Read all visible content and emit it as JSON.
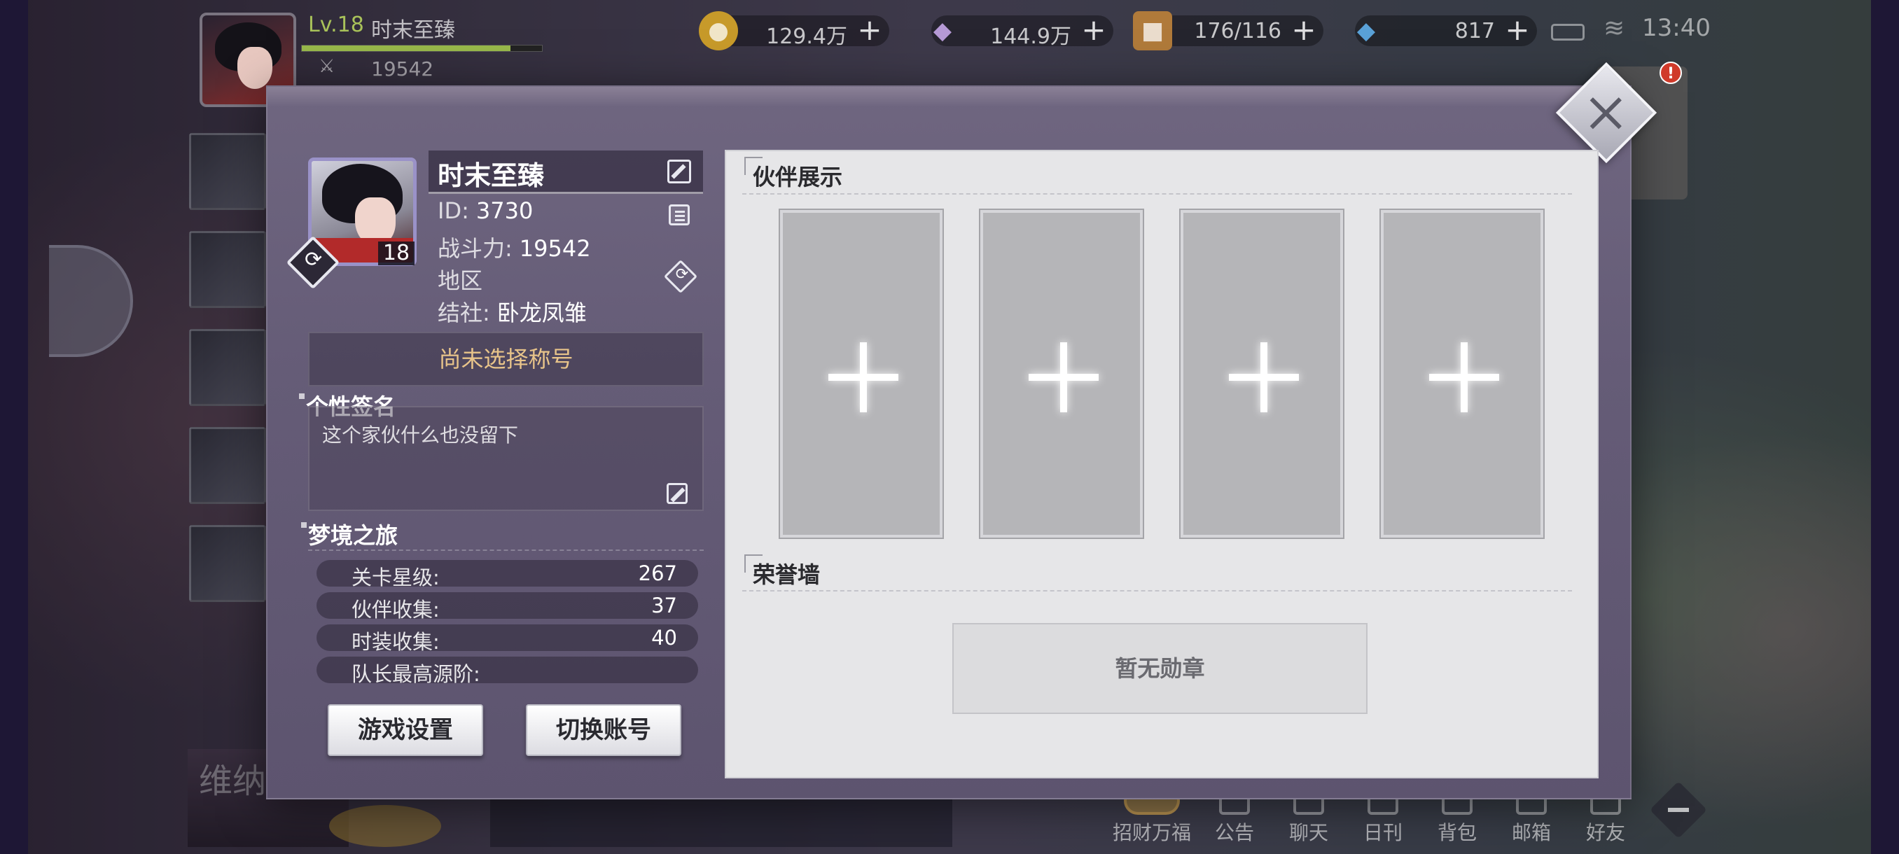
{
  "hud": {
    "level": "Lv.18",
    "player_name": "时末至臻",
    "power": "19542",
    "xp_fraction": 0.87,
    "resources": [
      {
        "icon": "gold-coin-icon",
        "value": "129.4万"
      },
      {
        "icon": "crystal-icon",
        "value": "144.9万"
      },
      {
        "icon": "stamina-chest-icon",
        "value": "176/116"
      },
      {
        "icon": "diamond-icon",
        "value": "817"
      }
    ],
    "time": "13:40"
  },
  "bottom_nav": [
    "招财万福",
    "公告",
    "聊天",
    "日刊",
    "背包",
    "邮箱",
    "好友"
  ],
  "profile": {
    "name": "时末至臻",
    "avatar_level": "18",
    "id_label": "ID:",
    "id_value": "3730",
    "power_label": "战斗力:",
    "power_value": "19542",
    "region_label": "地区",
    "guild_label": "结社:",
    "guild_value": "卧龙凤雏",
    "title_placeholder": "尚未选择称号",
    "signature_heading": "个性签名",
    "signature_text": "这个家伙什么也没留下",
    "dream_heading": "梦境之旅",
    "stats": [
      {
        "label": "关卡星级:",
        "value": "267"
      },
      {
        "label": "伙伴收集:",
        "value": "37"
      },
      {
        "label": "时装收集:",
        "value": "40"
      },
      {
        "label": "队长最高源阶:",
        "value": ""
      }
    ],
    "settings_button": "游戏设置",
    "switch_button": "切换账号"
  },
  "showcase": {
    "partner_heading": "伙伴展示",
    "slots": 4,
    "honor_heading": "荣誉墙",
    "no_medals": "暂无勋章"
  },
  "bg_text": "维纳"
}
